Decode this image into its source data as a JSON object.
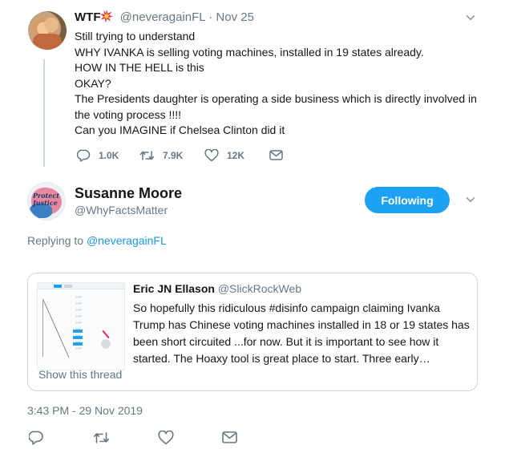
{
  "tweet1": {
    "author_name": "WTF",
    "handle": "@neveragainFL",
    "separator": "·",
    "date": "Nov 25",
    "lines": [
      "Still trying to understand",
      "WHY IVANKA is selling voting machines, installed in 19 states already.",
      "HOW IN THE HELL is this",
      "OKAY?",
      "The Presidents daughter is operating a side business which is directly involved in the voting process !!!!",
      "Can you IMAGINE if Chelsea  Clinton did it"
    ],
    "actions": {
      "replies": "1.0K",
      "retweets": "7.9K",
      "likes": "12K"
    }
  },
  "tweet2": {
    "author_name": "Susanne Moore",
    "handle": "@WhyFactsMatter",
    "follow_label": "Following",
    "replying_prefix": "Replying to",
    "replying_to": "@neveragainFL",
    "avatar_text": "Protect Justice",
    "timestamp": "3:43 PM - 29 Nov 2019"
  },
  "quote": {
    "author_name": "Eric JN Ellason",
    "handle": "@SlickRockWeb",
    "lines": [
      "So hopefully this ridiculous #disinfo campaign claiming Ivanka",
      "Trump has Chinese voting machines installed in 18 or 19 states has",
      "been short circuited ...for now. But it is important to see how it",
      "started. The Hoaxy tool is great place to start. Three early…"
    ],
    "show_thread": "Show this thread"
  },
  "colors": {
    "accent": "#1da1f2",
    "link": "#1b95e0",
    "muted": "#657786",
    "text": "#14171a",
    "border": "#ccd6dd"
  },
  "icons": [
    "reply-icon",
    "retweet-icon",
    "like-icon",
    "dm-icon",
    "chevron-down-icon",
    "collision-emoji-icon"
  ]
}
